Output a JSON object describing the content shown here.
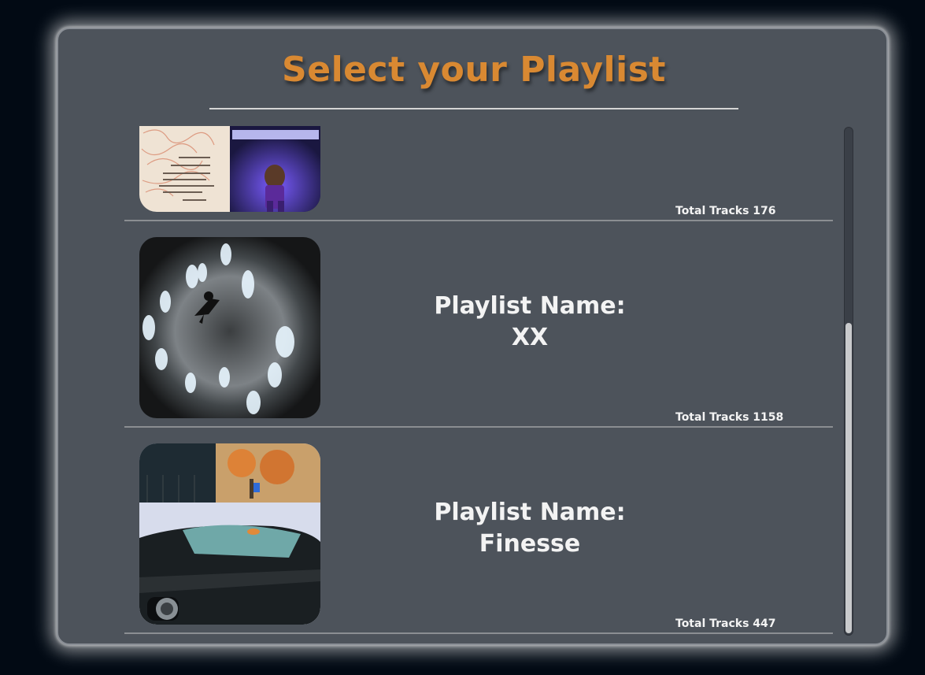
{
  "header": {
    "title": "Select your Playlist"
  },
  "playlists": [
    {
      "name_label": "",
      "name": "",
      "total_tracks": "Total Tracks 176",
      "cover_icon": "album-collage-cover"
    },
    {
      "name_label": "Playlist Name:",
      "name": "XX",
      "total_tracks": "Total Tracks 1158",
      "cover_icon": "figures-circle-cover"
    },
    {
      "name_label": "Playlist Name:",
      "name": "Finesse",
      "total_tracks": "Total Tracks 447",
      "cover_icon": "sports-car-cover"
    }
  ],
  "colors": {
    "background": "#020a14",
    "panel": "#4d535b",
    "title": "#d98932",
    "text": "#f3f3f3",
    "divider": "#8b8e92"
  }
}
